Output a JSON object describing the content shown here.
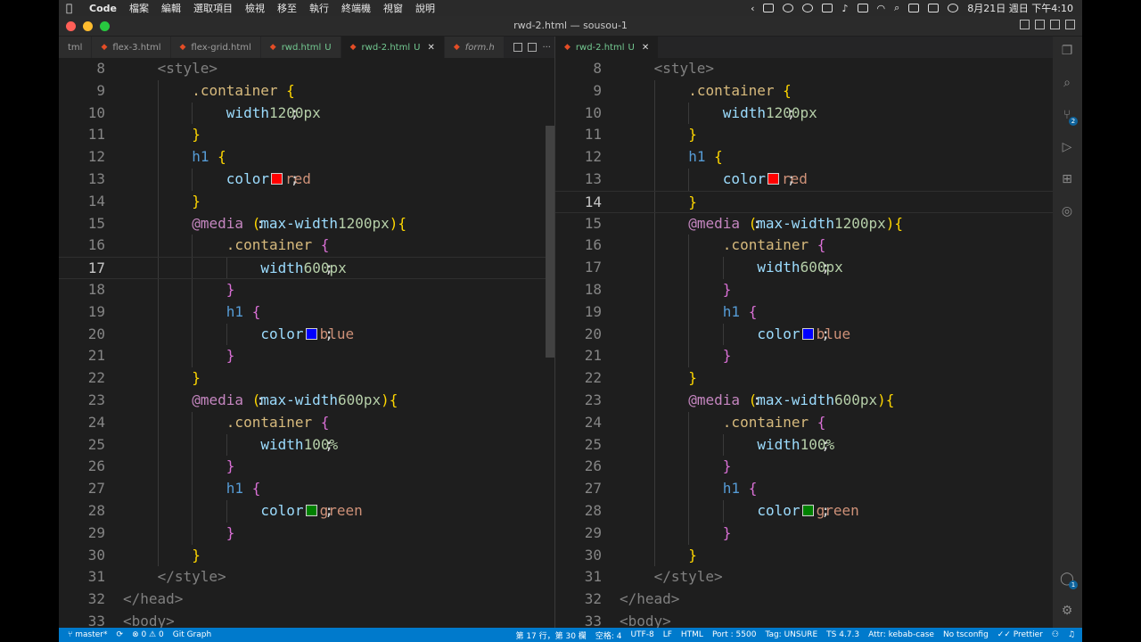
{
  "menubar": {
    "app": "Code",
    "items": [
      "檔案",
      "編輯",
      "選取項目",
      "檢視",
      "移至",
      "執行",
      "終端機",
      "視窗",
      "說明"
    ],
    "clock": "8月21日 週日 下午4:10"
  },
  "window": {
    "title": "rwd-2.html — sousou-1"
  },
  "colors": {
    "red": "#ff0000",
    "blue": "#0000ff",
    "green": "#008000",
    "statusbar": "#007acc"
  },
  "left_tabs": [
    {
      "label": "tml",
      "modified": false,
      "active": false
    },
    {
      "label": "flex-3.html",
      "modified": false,
      "active": false
    },
    {
      "label": "flex-grid.html",
      "modified": false,
      "active": false
    },
    {
      "label": "rwd.html",
      "mark": "U",
      "active": false
    },
    {
      "label": "rwd-2.html",
      "mark": "U",
      "active": true
    },
    {
      "label": "form.h",
      "active": false
    }
  ],
  "right_tabs": [
    {
      "label": "rwd-2.html",
      "mark": "U",
      "active": true
    }
  ],
  "code": {
    "line_numbers": [
      "8",
      "9",
      "10",
      "11",
      "12",
      "13",
      "14",
      "15",
      "16",
      "17",
      "18",
      "19",
      "20",
      "21",
      "22",
      "23",
      "24",
      "25",
      "26",
      "27",
      "28",
      "29",
      "30",
      "31",
      "32",
      "33"
    ],
    "t": {
      "style_open": "<style>",
      "style_close": "</style>",
      "head_close": "</head>",
      "body_open": "<body>",
      "container": ".container",
      "h1": "h1",
      "media": "@media",
      "open": "{",
      "close": "}",
      "lparen": "(",
      "rparen": ")",
      "width": "width",
      "color": "color",
      "colon": ": ",
      "semi": ";",
      "maxw": "max-width",
      "mq_colon": ":",
      "v1200": "1200px",
      "v600": "600px",
      "v100": "100%",
      "red": "red",
      "blue": "blue",
      "green": "green"
    }
  },
  "left_pane": {
    "cursor_line": "17"
  },
  "right_pane": {
    "cursor_line": "14"
  },
  "status": {
    "branch": "master*",
    "problems": "⊗ 0 ⚠ 0",
    "git_graph": "Git Graph",
    "position": "第 17 行，第 30 欄",
    "spaces": "空格: 4",
    "encoding": "UTF-8",
    "eol": "LF",
    "language": "HTML",
    "port": "Port : 5500",
    "tag": "Tag: UNSURE",
    "ts": "TS 4.7.3",
    "attr": "Attr: kebab-case",
    "tsconfig": "No tsconfig",
    "prettier": "✓✓ Prettier"
  },
  "activity_badges": {
    "scm": "2",
    "account": "1"
  }
}
